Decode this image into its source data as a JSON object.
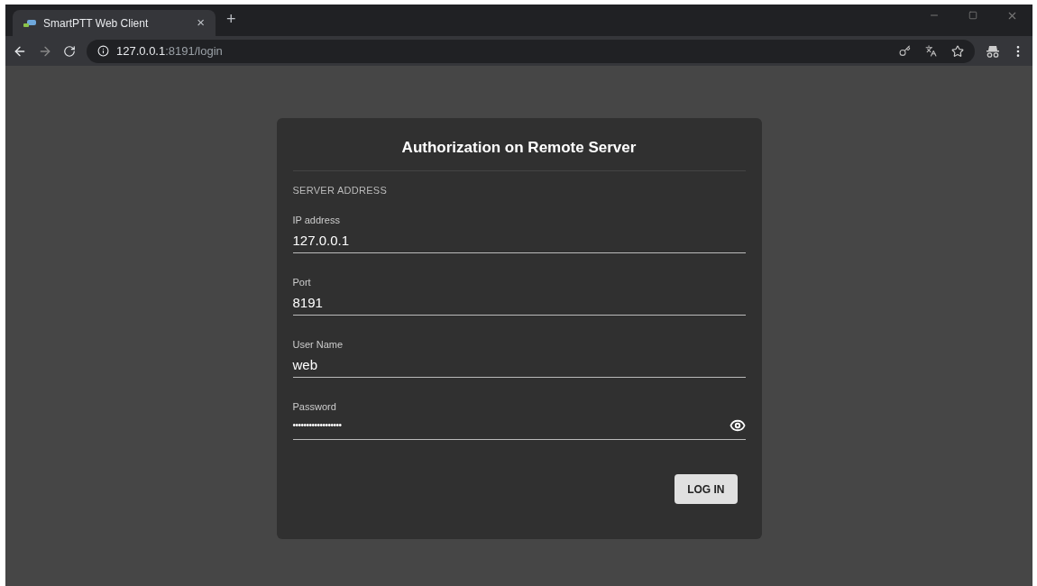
{
  "browser": {
    "tab": {
      "title": "SmartPTT Web Client",
      "close": "×",
      "selected": true
    },
    "new_tab": "+",
    "url": {
      "host": "127.0.0.1",
      "path": ":8191/login"
    }
  },
  "card": {
    "title": "Authorization on Remote Server",
    "section": "SERVER ADDRESS",
    "fields": [
      {
        "label": "IP address",
        "value": "127.0.0.1",
        "kind": "text"
      },
      {
        "label": "Port",
        "value": "8191",
        "kind": "text"
      },
      {
        "label": "User Name",
        "value": "web",
        "kind": "text"
      },
      {
        "label": "Password",
        "value": "••••••••••••••••••",
        "kind": "password"
      }
    ],
    "button": "LOG IN"
  }
}
